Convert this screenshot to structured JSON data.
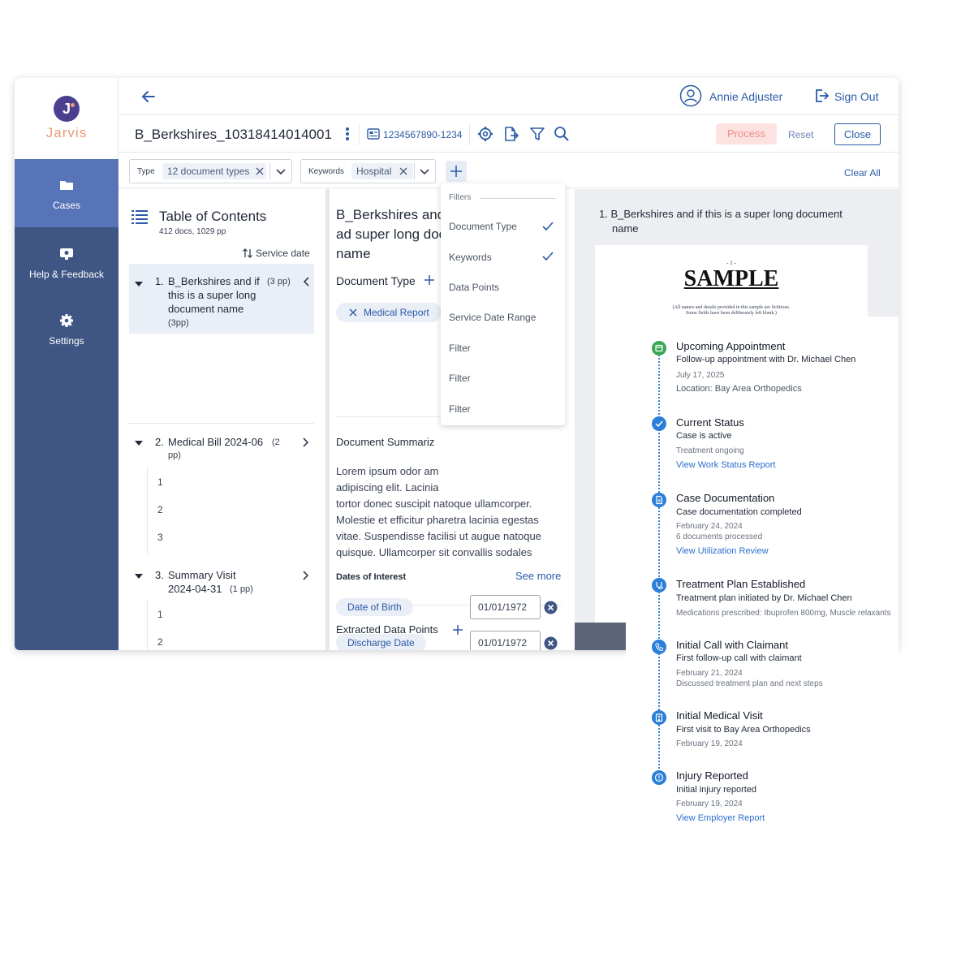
{
  "app": {
    "logo_text": "Jarvis",
    "logo_letter": "J"
  },
  "sidebar": {
    "items": [
      {
        "label": "Cases",
        "icon": "folder-icon",
        "active": true
      },
      {
        "label": "Help & Feedback",
        "icon": "monitor-help-icon",
        "active": false
      },
      {
        "label": "Settings",
        "icon": "gear-icon",
        "active": false
      }
    ]
  },
  "header": {
    "user_name": "Annie Adjuster",
    "sign_out_label": "Sign Out"
  },
  "titlebar": {
    "doc_title": "B_Berkshires_10318414014001",
    "claim_number": "1234567890-1234",
    "process_label": "Process",
    "reset_label": "Reset",
    "close_label": "Close"
  },
  "filterbar": {
    "type_label": "Type",
    "type_value": "12 document types",
    "keywords_label": "Keywords",
    "keywords_value": "Hospital",
    "clear_all_label": "Clear All"
  },
  "filters_menu": {
    "header": "Filters",
    "items": [
      {
        "label": "Document Type",
        "checked": true
      },
      {
        "label": "Keywords",
        "checked": true
      },
      {
        "label": "Data Points",
        "checked": false
      },
      {
        "label": "Service Date Range",
        "checked": false
      },
      {
        "label": "Filter",
        "checked": false
      },
      {
        "label": "Filter",
        "checked": false
      },
      {
        "label": "Filter",
        "checked": false
      }
    ]
  },
  "toc": {
    "title": "Table of Contents",
    "subtitle": "412 docs, 1029 pp",
    "sort_label": "Service date",
    "entries": [
      {
        "number": "1.",
        "title_lines": [
          "B_Berkshires and if",
          "this is a super long",
          "document name"
        ],
        "pp": "(3 pp)",
        "pp_sub": "(3pp)"
      },
      {
        "number": "2.",
        "title_lines": [
          "Medical Bill 2024-06"
        ],
        "pp": "(2",
        "pp_sub": "pp)",
        "pages": [
          "1",
          "2",
          "3"
        ]
      },
      {
        "number": "3.",
        "title_lines": [
          "Summary Visit",
          "2024-04-31"
        ],
        "pp": "(1 pp)",
        "pages": [
          "1",
          "2"
        ]
      }
    ]
  },
  "detail": {
    "title_lines": [
      "B_Berkshires and",
      "ad super long doc",
      "name"
    ],
    "doc_type_heading": "Document Type",
    "doc_type_tag": "Medical Report",
    "summary_heading": "Document Summariz",
    "summary_lines": [
      "Lorem ipsum odor am",
      "adipiscing elit. Lacinia",
      "tortor donec suscipit natoque ullamcorper.",
      "Molestie et efficitur pharetra lacinia egestas",
      "vitae. Suspendisse facilisi ut augue natoque",
      "quisque. Ullamcorper sit convallis sodales"
    ],
    "see_more_label": "See more",
    "extracted_heading": "Extracted Data Points",
    "dates_label": "Dates of Interest",
    "data_points": [
      {
        "label": "Date of Birth",
        "value": "01/01/1972"
      },
      {
        "label": "Discharge Date",
        "value": "01/01/1972"
      }
    ]
  },
  "preview": {
    "title_lines": [
      "1. B_Berkshires and if this is a super long document",
      "name"
    ],
    "page_number": "- 1 -",
    "sample_word": "SAMPLE",
    "note_line1": "(All names and details provided in this sample are fictitious.",
    "note_line2": "Some fields have been deliberately left blank.)"
  },
  "timeline": {
    "events": [
      {
        "title": "Upcoming Appointment",
        "line": "Follow-up appointment with Dr. Michael Chen",
        "meta": [
          "July 17, 2025"
        ],
        "detail": "Location: Bay Area Orthopedics",
        "link": "",
        "icon": "calendar-icon",
        "color": "#3aa757"
      },
      {
        "title": "Current Status",
        "line": "Case is active",
        "meta": [
          "Treatment ongoing"
        ],
        "detail": "",
        "link": "View Work Status Report",
        "icon": "check-icon",
        "color": "#2b7fd9"
      },
      {
        "title": "Case Documentation",
        "line": "Case documentation completed",
        "meta": [
          "February 24, 2024",
          "6 documents processed"
        ],
        "detail": "",
        "link": "View Utilization Review",
        "icon": "document-icon",
        "color": "#2b7fd9"
      },
      {
        "title": "Treatment Plan Established",
        "line": "Treatment plan initiated by Dr. Michael Chen",
        "meta": [
          "Medications prescribed: Ibuprofen 800mg, Muscle relaxants"
        ],
        "detail": "",
        "link": "",
        "icon": "stethoscope-icon",
        "color": "#2b7fd9"
      },
      {
        "title": "Initial Call with Claimant",
        "line": "First follow-up call with claimant",
        "meta": [
          "February 21, 2024",
          "Discussed treatment plan and next steps"
        ],
        "detail": "",
        "link": "",
        "icon": "phone-icon",
        "color": "#2b7fd9"
      },
      {
        "title": "Initial Medical Visit",
        "line": "First visit to Bay Area Orthopedics",
        "meta": [
          "February 19, 2024"
        ],
        "detail": "",
        "link": "",
        "icon": "hospital-icon",
        "color": "#2b7fd9"
      },
      {
        "title": "Injury Reported",
        "line": "Initial injury reported",
        "meta": [
          "February 19, 2024"
        ],
        "detail": "",
        "link": "View Employer Report",
        "icon": "alert-icon",
        "color": "#2b7fd9"
      }
    ]
  },
  "colors": {
    "sidebar": "#3f5584",
    "sidebar_active": "#5874b8",
    "primary": "#2b5aa6",
    "logo_text": "#e99a77"
  }
}
